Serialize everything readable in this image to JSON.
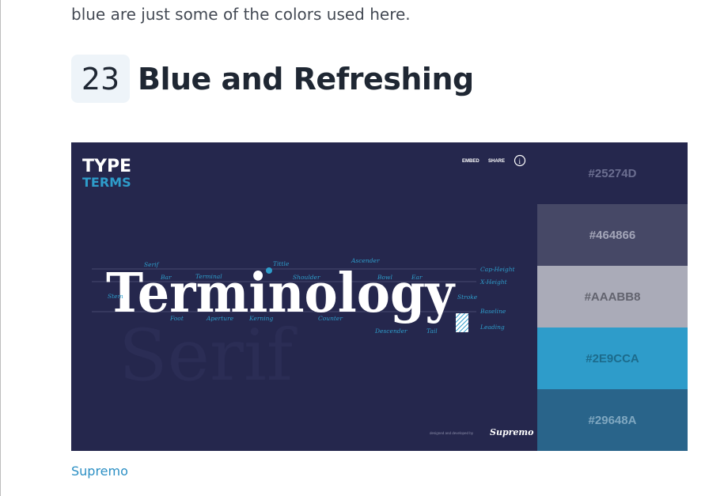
{
  "intro": {
    "text": "blue are just some of the colors used here."
  },
  "heading": {
    "number": "23",
    "title": "Blue and Refreshing"
  },
  "screenshot": {
    "logo": {
      "line1": "TYPE",
      "line2": "TERMS"
    },
    "nav": {
      "embed": "EMBED",
      "share": "SHARE",
      "info": "i"
    },
    "hero_word": "Terminology",
    "terms": {
      "serif": "Serif",
      "bar": "Bar",
      "terminal": "Terminal",
      "tittle": "Tittle",
      "shoulder": "Shoulder",
      "ascender": "Ascender",
      "bowl": "Bowl",
      "ear": "Ear",
      "stem": "Stem",
      "foot": "Foot",
      "aperture": "Aperture",
      "kerning": "Kerning",
      "counter": "Counter",
      "descender": "Descender",
      "tail": "Tail",
      "stroke": "Stroke",
      "cap_height": "Cap-Height",
      "x_height": "X-Height",
      "baseline": "Baseline",
      "leading": "Leading"
    },
    "credit": {
      "prefix": "designed and developed by",
      "brand": "Supremo"
    }
  },
  "palette": [
    {
      "hex": "#25274D",
      "bg": "#25274d",
      "fg": "#6b6e90"
    },
    {
      "hex": "#464866",
      "bg": "#464866",
      "fg": "#a3a5b8"
    },
    {
      "hex": "#AAABB8",
      "bg": "#aaabb8",
      "fg": "#62636e"
    },
    {
      "hex": "#2E9CCA",
      "bg": "#2e9cca",
      "fg": "#1c6b8c"
    },
    {
      "hex": "#29648A",
      "bg": "#29648a",
      "fg": "#7fa7c0"
    }
  ],
  "caption": {
    "link": "Supremo"
  }
}
